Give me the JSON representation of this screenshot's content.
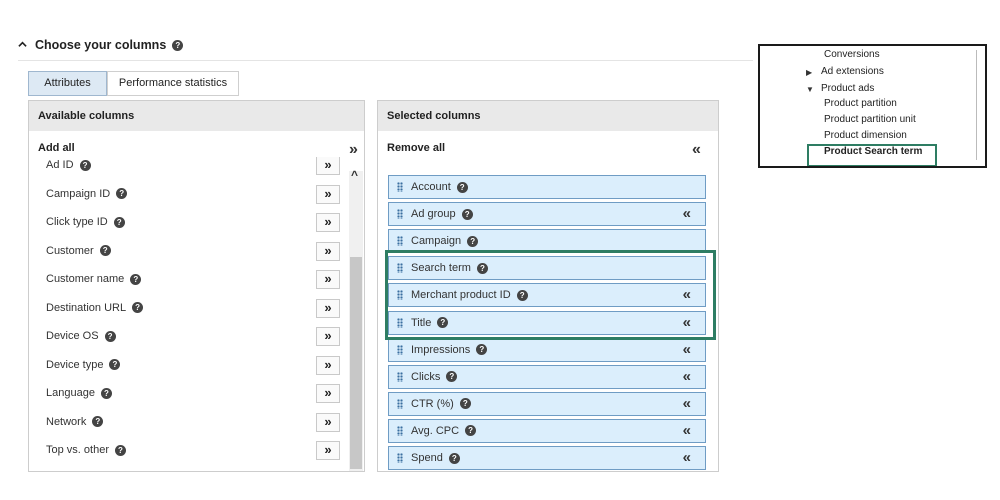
{
  "header": {
    "title": "Choose your columns"
  },
  "tabs": [
    {
      "label": "Attributes",
      "active": true
    },
    {
      "label": "Performance statistics",
      "active": false
    }
  ],
  "available": {
    "title": "Available columns",
    "add_all": "Add all",
    "items": [
      "Ad ID",
      "Campaign ID",
      "Click type ID",
      "Customer",
      "Customer name",
      "Destination URL",
      "Device OS",
      "Device type",
      "Language",
      "Network",
      "Top vs. other"
    ]
  },
  "selected": {
    "title": "Selected columns",
    "remove_all": "Remove all",
    "items": [
      {
        "label": "Account",
        "removable": false
      },
      {
        "label": "Ad group",
        "removable": true
      },
      {
        "label": "Campaign",
        "removable": false
      },
      {
        "label": "Search term",
        "removable": false
      },
      {
        "label": "Merchant product ID",
        "removable": true
      },
      {
        "label": "Title",
        "removable": true
      },
      {
        "label": "Impressions",
        "removable": true
      },
      {
        "label": "Clicks",
        "removable": true
      },
      {
        "label": "CTR (%)",
        "removable": true
      },
      {
        "label": "Avg. CPC",
        "removable": true
      },
      {
        "label": "Spend",
        "removable": true
      }
    ]
  },
  "tree": {
    "items": [
      {
        "label": "Conversions",
        "expander": "",
        "bold": false
      },
      {
        "label": "Ad extensions",
        "expander": "collapsed",
        "bold": false
      },
      {
        "label": "Product ads",
        "expander": "expanded",
        "bold": false
      },
      {
        "label": "Product partition",
        "expander": "",
        "bold": false
      },
      {
        "label": "Product partition unit",
        "expander": "",
        "bold": false
      },
      {
        "label": "Product dimension",
        "expander": "",
        "bold": false
      },
      {
        "label": "Product Search term",
        "expander": "",
        "bold": true
      }
    ]
  },
  "icons": {
    "help": "question-circle-icon",
    "collapse": "chevron-up-icon",
    "add": "double-chevron-right-icon",
    "remove": "double-chevron-left-icon",
    "grip": "drag-handle-icon"
  },
  "colors": {
    "highlight": "#2e7d63",
    "selected_item_bg": "#dbeefc",
    "selected_item_border": "#6f9cc4",
    "active_tab_bg": "#dde9f4"
  }
}
